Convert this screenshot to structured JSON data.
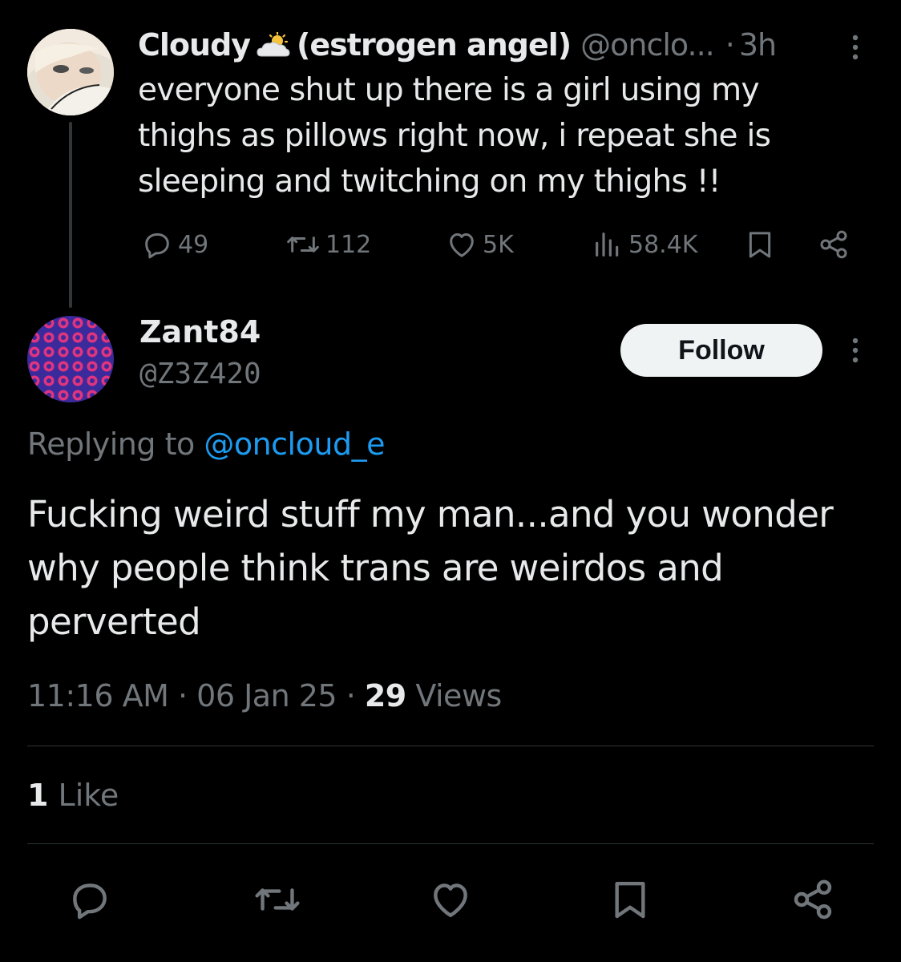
{
  "parent_tweet": {
    "display_name": "Cloudy",
    "display_name_suffix": "(estrogen angel)",
    "handle": "@onclo...",
    "separator": "·",
    "time": "3h",
    "text": "everyone shut up there is a girl using my thighs as pillows right now, i repeat she is sleeping and twitching on my thighs !!",
    "actions": {
      "replies": "49",
      "reposts": "112",
      "likes": "5K",
      "views": "58.4K"
    }
  },
  "reply_tweet": {
    "display_name": "Zant84",
    "handle": "@Z3Z420",
    "follow_label": "Follow",
    "replying_prefix": "Replying to",
    "replying_to": "@oncloud_e",
    "text": "Fucking weird stuff my man...and you wonder why people think trans are weirdos and perverted",
    "time": "11:16 AM",
    "date": "06 Jan 25",
    "views_count": "29",
    "views_label": "Views",
    "likes_count": "1",
    "likes_label": "Like"
  },
  "icons": {
    "reply": "reply-icon",
    "repost": "repost-icon",
    "like": "heart-icon",
    "views": "views-icon",
    "bookmark": "bookmark-icon",
    "share": "share-icon",
    "more": "more-icon"
  },
  "colors": {
    "background": "#000000",
    "text": "#e7e9ea",
    "muted": "#71767b",
    "link": "#1d9bf0",
    "follow_button_bg": "#eff3f4"
  }
}
